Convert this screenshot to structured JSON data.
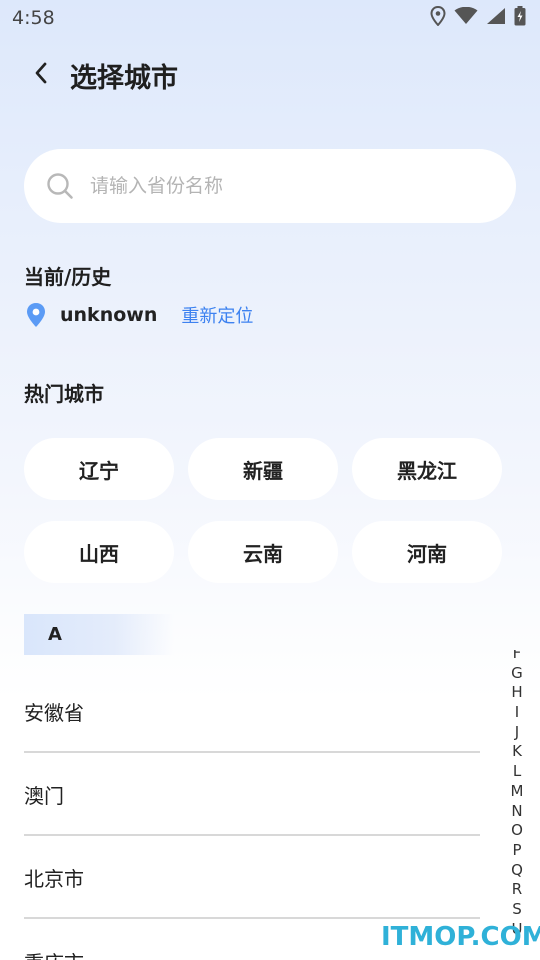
{
  "status_bar": {
    "time": "4:58"
  },
  "header": {
    "title": "选择城市",
    "back_icon": "chevron-left-icon"
  },
  "search": {
    "placeholder": "请输入省份名称",
    "value": ""
  },
  "current": {
    "section_title": "当前/历史",
    "city": "unknown",
    "relocate_label": "重新定位",
    "accent_color": "#3d82f0"
  },
  "hot": {
    "section_title": "热门城市",
    "cities": [
      "辽宁",
      "新疆",
      "黑龙江",
      "山西",
      "云南",
      "河南"
    ]
  },
  "list": {
    "group_letter": "A",
    "items": [
      "安徽省",
      "澳门",
      "北京市",
      "重庆市"
    ]
  },
  "index_bar": [
    "F",
    "G",
    "H",
    "I",
    "J",
    "K",
    "L",
    "M",
    "N",
    "O",
    "P",
    "Q",
    "R",
    "S",
    "U"
  ],
  "watermark": "ITMOP.COM"
}
